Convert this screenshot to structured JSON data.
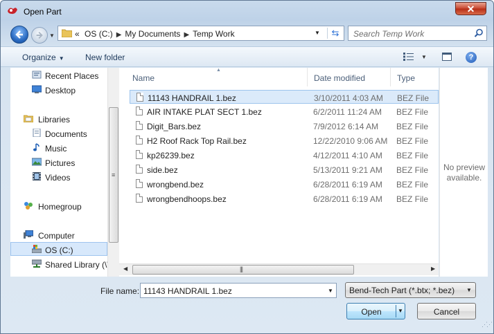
{
  "window": {
    "title": "Open Part"
  },
  "nav": {
    "breadcrumb": [
      "OS (C:)",
      "My Documents",
      "Temp Work"
    ],
    "overflow": "«",
    "search_placeholder": "Search Temp Work"
  },
  "toolbar": {
    "organize": "Organize",
    "new_folder": "New folder"
  },
  "navpane": {
    "items": [
      {
        "label": "Recent Places",
        "icon": "recent-places-icon"
      },
      {
        "label": "Desktop",
        "icon": "desktop-icon"
      },
      {
        "label": "Libraries",
        "icon": "libraries-icon"
      },
      {
        "label": "Documents",
        "icon": "documents-icon"
      },
      {
        "label": "Music",
        "icon": "music-icon"
      },
      {
        "label": "Pictures",
        "icon": "pictures-icon"
      },
      {
        "label": "Videos",
        "icon": "videos-icon"
      },
      {
        "label": "Homegroup",
        "icon": "homegroup-icon"
      },
      {
        "label": "Computer",
        "icon": "computer-icon"
      },
      {
        "label": "OS (C:)",
        "icon": "drive-icon"
      },
      {
        "label": "Shared Library (\\\\",
        "icon": "network-drive-icon"
      }
    ],
    "selected": "OS (C:)"
  },
  "columns": {
    "name": "Name",
    "date": "Date modified",
    "type": "Type"
  },
  "files": [
    {
      "name": "11143 HANDRAIL 1.bez",
      "date": "3/10/2011 4:03 AM",
      "type": "BEZ File",
      "selected": true
    },
    {
      "name": "AIR INTAKE PLAT SECT 1.bez",
      "date": "6/2/2011 11:24 AM",
      "type": "BEZ File"
    },
    {
      "name": "Digit_Bars.bez",
      "date": "7/9/2012 6:14 AM",
      "type": "BEZ File"
    },
    {
      "name": "H2 Roof Rack Top Rail.bez",
      "date": "12/22/2010 9:06 AM",
      "type": "BEZ File"
    },
    {
      "name": "kp26239.bez",
      "date": "4/12/2011 4:10 AM",
      "type": "BEZ File"
    },
    {
      "name": "side.bez",
      "date": "5/13/2011 9:21 AM",
      "type": "BEZ File"
    },
    {
      "name": "wrongbend.bez",
      "date": "6/28/2011 6:19 AM",
      "type": "BEZ File"
    },
    {
      "name": "wrongbendhoops.bez",
      "date": "6/28/2011 6:19 AM",
      "type": "BEZ File"
    }
  ],
  "preview": {
    "line1": "No preview",
    "line2": "available."
  },
  "footer": {
    "file_name_label": "File name:",
    "file_name_value": "11143 HANDRAIL 1.bez",
    "file_type": "Bend-Tech Part (*.btx; *.bez)",
    "open": "Open",
    "cancel": "Cancel"
  },
  "colors": {
    "selection": "#dbeafa",
    "selection_border": "#9cc3ec",
    "close": "#c7462f",
    "accent": "#2b6cc2"
  }
}
